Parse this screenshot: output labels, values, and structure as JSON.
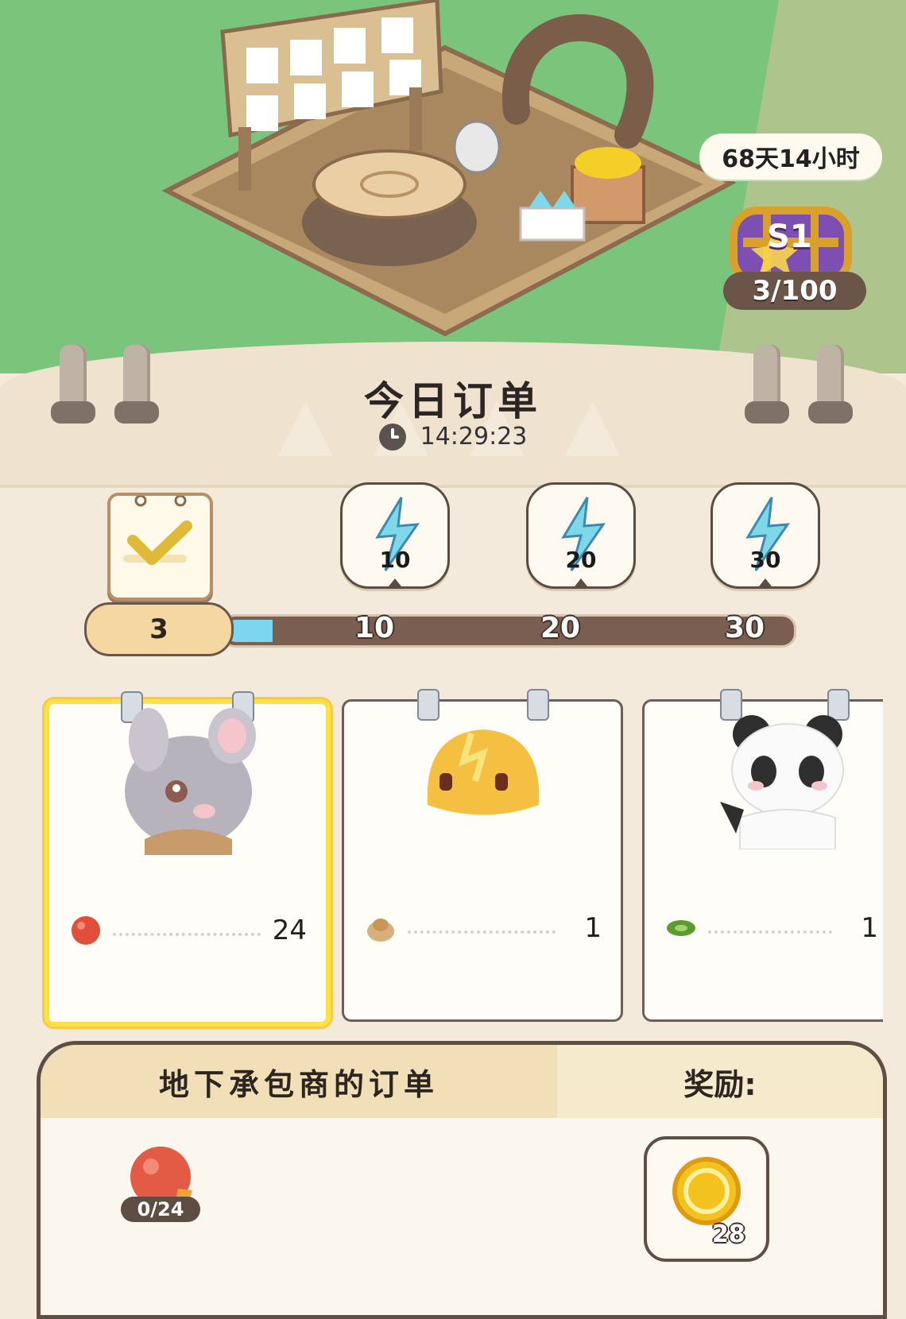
{
  "event": {
    "time_remaining": "68天14小时",
    "season_label": "S1",
    "season_progress": "3/100"
  },
  "header": {
    "title": "今日订单",
    "countdown": "14:29:23"
  },
  "progress": {
    "completed_count": "3",
    "fill_fraction": 0.1,
    "milestones": [
      {
        "value": "10",
        "reward_amount": "10",
        "icon": "lightning-icon"
      },
      {
        "value": "20",
        "reward_amount": "20",
        "icon": "lightning-icon"
      },
      {
        "value": "30",
        "reward_amount": "30",
        "icon": "lightning-icon"
      }
    ]
  },
  "orders": [
    {
      "character": "hamster",
      "item_icon": "red-berry-icon",
      "count": "24",
      "selected": true
    },
    {
      "character": "yellow-slime",
      "item_icon": "bread-roll-icon",
      "count": "1",
      "selected": false
    },
    {
      "character": "panda",
      "item_icon": "green-leaf-icon",
      "count": "1",
      "selected": false
    }
  ],
  "contractor": {
    "title": "地下承包商的订单",
    "reward_label": "奖励:",
    "item_progress": "0/24",
    "reward_coin_count": "28"
  },
  "colors": {
    "selected_card_border": "#ffe146",
    "progress_fill": "#7cd6ee",
    "grass": "#7bc47c"
  }
}
